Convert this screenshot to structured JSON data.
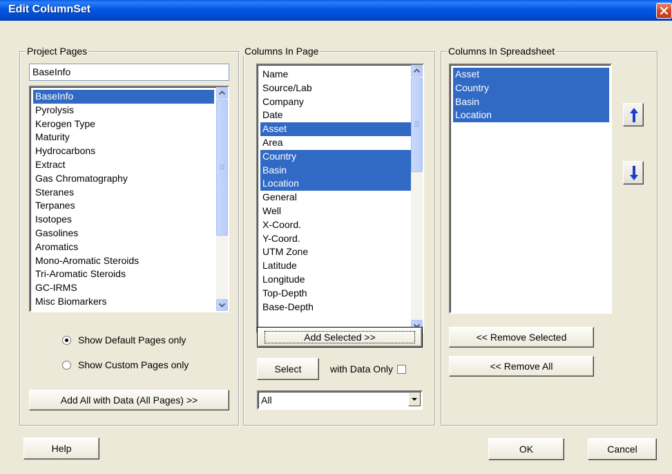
{
  "window": {
    "title": "Edit ColumnSet",
    "colors": {
      "titlebar": "#0058e6",
      "selection": "#316ac5",
      "face": "#ece9d8"
    }
  },
  "project_pages": {
    "legend": "Project Pages",
    "current_value": "BaseInfo",
    "items": [
      {
        "label": "BaseInfo",
        "selected": true
      },
      {
        "label": "Pyrolysis",
        "selected": false
      },
      {
        "label": "Kerogen Type",
        "selected": false
      },
      {
        "label": "Maturity",
        "selected": false
      },
      {
        "label": "Hydrocarbons",
        "selected": false
      },
      {
        "label": "Extract",
        "selected": false
      },
      {
        "label": "Gas Chromatography",
        "selected": false
      },
      {
        "label": "Steranes",
        "selected": false
      },
      {
        "label": "Terpanes",
        "selected": false
      },
      {
        "label": "Isotopes",
        "selected": false
      },
      {
        "label": "Gasolines",
        "selected": false
      },
      {
        "label": "Aromatics",
        "selected": false
      },
      {
        "label": "Mono-Aromatic Steroids",
        "selected": false
      },
      {
        "label": "Tri-Aromatic Steroids",
        "selected": false
      },
      {
        "label": "GC-IRMS",
        "selected": false
      },
      {
        "label": "Misc Biomarkers",
        "selected": false
      }
    ],
    "radio_default": "Show Default Pages only",
    "radio_custom": "Show Custom Pages only",
    "radio_selected": "default",
    "add_all_button": "Add All with Data (All Pages) >>"
  },
  "columns_in_page": {
    "legend": "Columns In Page",
    "items": [
      {
        "label": "Name",
        "selected": false
      },
      {
        "label": "Source/Lab",
        "selected": false
      },
      {
        "label": "Company",
        "selected": false
      },
      {
        "label": "Date",
        "selected": false
      },
      {
        "label": "Asset",
        "selected": true
      },
      {
        "label": "Area",
        "selected": false
      },
      {
        "label": "Country",
        "selected": true
      },
      {
        "label": "Basin",
        "selected": true
      },
      {
        "label": "Location",
        "selected": true
      },
      {
        "label": "General",
        "selected": false
      },
      {
        "label": "Well",
        "selected": false
      },
      {
        "label": "X-Coord.",
        "selected": false
      },
      {
        "label": "Y-Coord.",
        "selected": false
      },
      {
        "label": "UTM Zone",
        "selected": false
      },
      {
        "label": "Latitude",
        "selected": false
      },
      {
        "label": "Longitude",
        "selected": false
      },
      {
        "label": "Top-Depth",
        "selected": false
      },
      {
        "label": "Base-Depth",
        "selected": false
      }
    ],
    "add_selected_button": "Add Selected >>",
    "select_button": "Select",
    "with_data_only_label": "with Data Only",
    "with_data_only_checked": false,
    "filter_value": "All"
  },
  "columns_in_spreadsheet": {
    "legend": "Columns In Spreadsheet",
    "items": [
      {
        "label": "Asset",
        "selected": true
      },
      {
        "label": "Country",
        "selected": true
      },
      {
        "label": "Basin",
        "selected": true
      },
      {
        "label": "Location",
        "selected": true
      }
    ],
    "remove_selected_button": "<< Remove Selected",
    "remove_all_button": "<< Remove All",
    "move_up_icon": "up-arrow-icon",
    "move_down_icon": "down-arrow-icon"
  },
  "footer": {
    "help_button": "Help",
    "ok_button": "OK",
    "cancel_button": "Cancel"
  }
}
